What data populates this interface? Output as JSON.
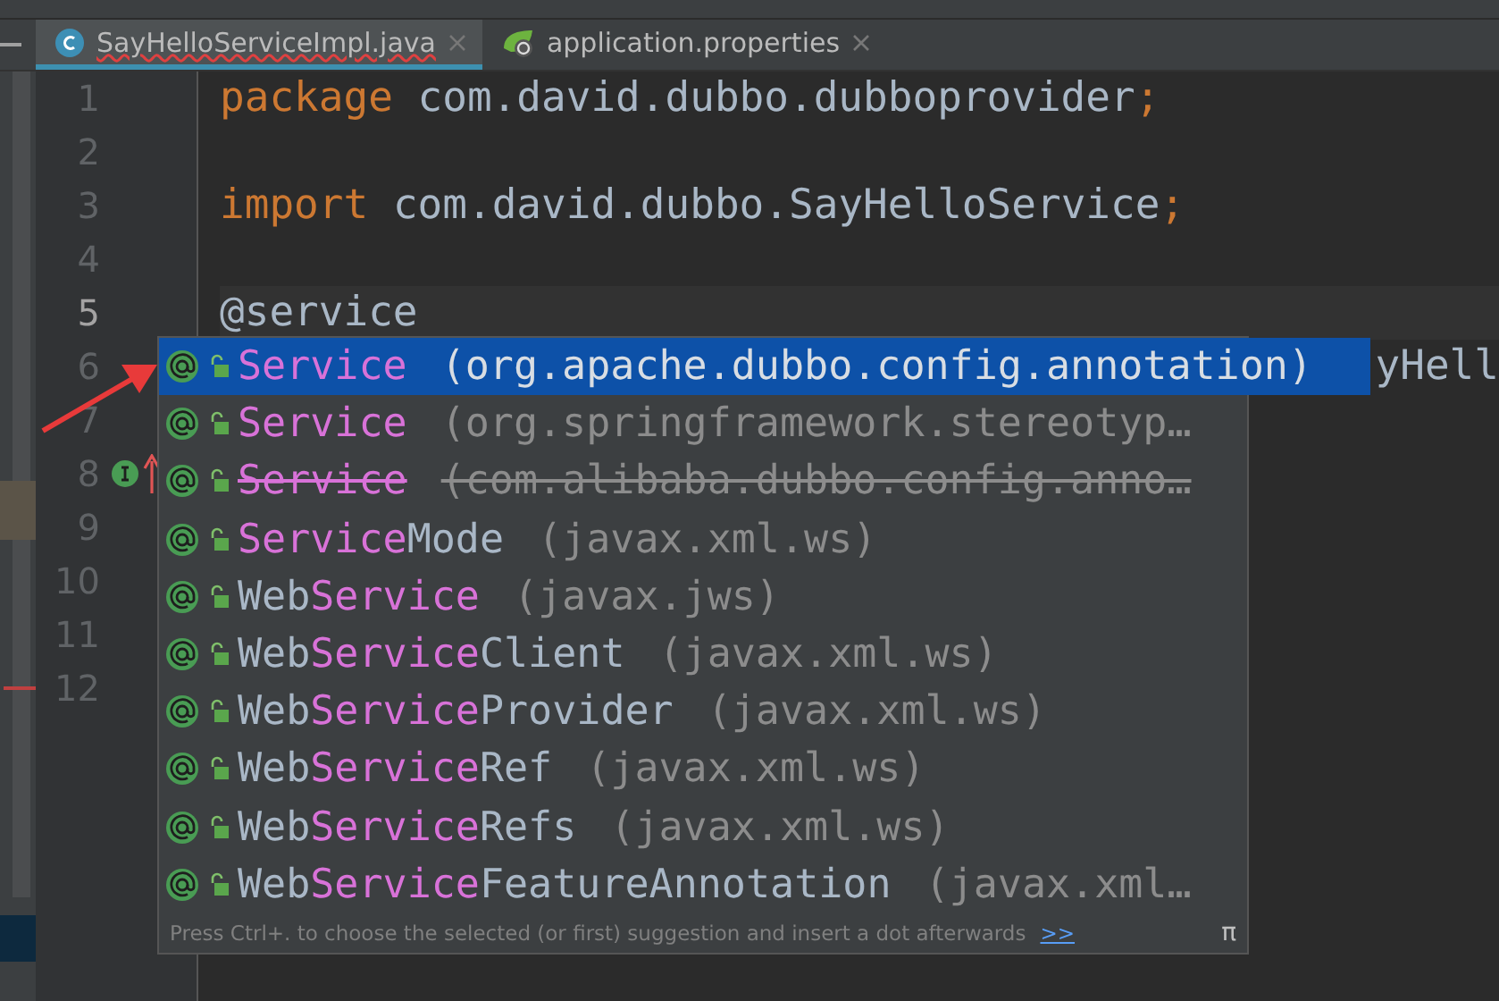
{
  "tabs": [
    {
      "label": "SayHelloServiceImpl.java",
      "kind": "java",
      "selected": true,
      "error": true
    },
    {
      "label": "application.properties",
      "kind": "spring",
      "selected": false,
      "error": false
    }
  ],
  "code_lines": [
    {
      "number": "1",
      "current": false,
      "tokens": [
        {
          "kind": "keyword",
          "text": "package"
        },
        {
          "kind": "plain",
          "text": " com.david.dubbo.dubboprovider"
        },
        {
          "kind": "keyword",
          "text": ";"
        }
      ]
    },
    {
      "number": "2",
      "current": false
    },
    {
      "number": "3",
      "current": false,
      "tokens": [
        {
          "kind": "keyword",
          "text": "import"
        },
        {
          "kind": "plain",
          "text": " com.david.dubbo.SayHelloService"
        },
        {
          "kind": "keyword",
          "text": ";"
        }
      ]
    },
    {
      "number": "4",
      "current": false
    },
    {
      "number": "5",
      "current": true,
      "tokens": [
        {
          "kind": "plain",
          "text": "@service"
        }
      ]
    },
    {
      "number": "6",
      "current": false,
      "tokens": [
        {
          "kind": "hidden",
          "text": "yHell"
        }
      ]
    },
    {
      "number": "7",
      "current": false
    },
    {
      "number": "8",
      "current": false
    },
    {
      "number": "9",
      "current": false
    },
    {
      "number": "10",
      "current": false
    },
    {
      "number": "11",
      "current": false
    },
    {
      "number": "12",
      "current": false
    }
  ],
  "completion_popup": {
    "items": [
      {
        "match": "Service",
        "package": "(org.apache.dubbo.config.annotation)",
        "deprecated": false,
        "selected": true
      },
      {
        "match": "Service",
        "package": "(org.springframework.stereotyp…",
        "deprecated": false,
        "selected": false
      },
      {
        "match": "Service",
        "package": "(com.alibaba.dubbo.config.anno…",
        "deprecated": true,
        "selected": false
      },
      {
        "match": "Service",
        "suffix": "Mode",
        "package": "(javax.xml.ws)",
        "deprecated": false,
        "selected": false
      },
      {
        "prefix": "Web",
        "match": "Service",
        "package": "(javax.jws)",
        "deprecated": false,
        "selected": false
      },
      {
        "prefix": "Web",
        "match": "Service",
        "suffix": "Client",
        "package": "(javax.xml.ws)",
        "deprecated": false,
        "selected": false
      },
      {
        "prefix": "Web",
        "match": "Service",
        "suffix": "Provider",
        "package": "(javax.xml.ws)",
        "deprecated": false,
        "selected": false
      },
      {
        "prefix": "Web",
        "match": "Service",
        "suffix": "Ref",
        "package": "(javax.xml.ws)",
        "deprecated": false,
        "selected": false
      },
      {
        "prefix": "Web",
        "match": "Service",
        "suffix": "Refs",
        "package": "(javax.xml.ws)",
        "deprecated": false,
        "selected": false
      },
      {
        "prefix": "Web",
        "match": "Service",
        "suffix": "FeatureAnnotation",
        "package": "(javax.xml…",
        "deprecated": false,
        "selected": false
      }
    ],
    "hint": "Press Ctrl+. to choose the selected (or first) suggestion and insert a dot afterwards",
    "hint_link": ">>",
    "pi_symbol": "π"
  }
}
